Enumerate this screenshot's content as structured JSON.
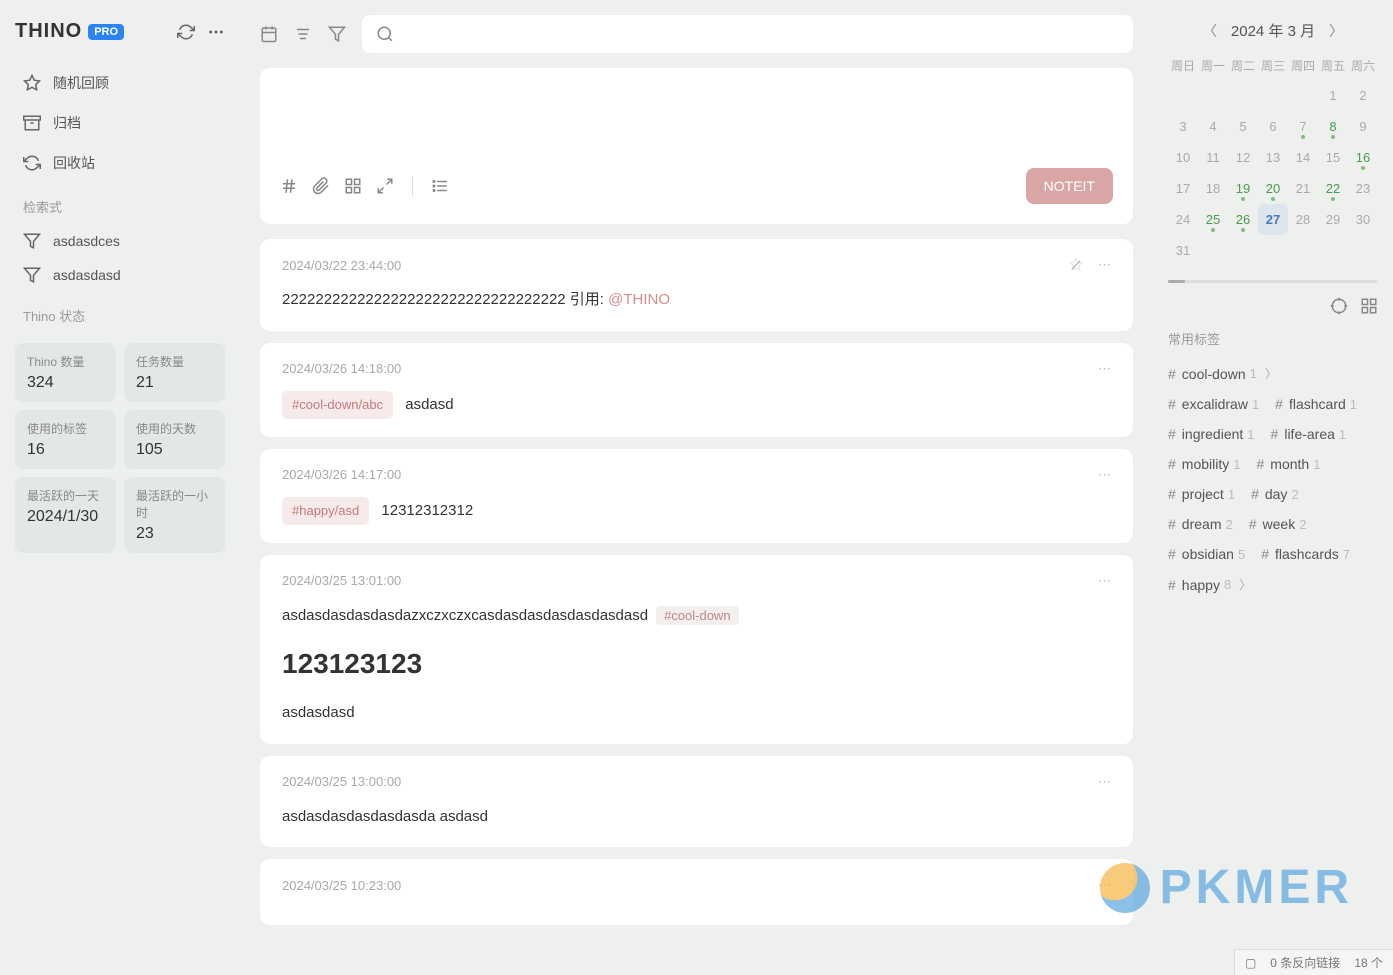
{
  "brand": {
    "title": "THINO",
    "badge": "PRO"
  },
  "sidebar": {
    "nav": [
      {
        "label": "随机回顾",
        "icon": "star"
      },
      {
        "label": "归档",
        "icon": "archive"
      },
      {
        "label": "回收站",
        "icon": "recycle"
      }
    ],
    "search_label": "检索式",
    "filters": [
      {
        "label": "asdasdces"
      },
      {
        "label": "asdasdasd"
      }
    ],
    "stats_label": "Thino 状态",
    "stats": [
      {
        "label": "Thino 数量",
        "value": "324"
      },
      {
        "label": "任务数量",
        "value": "21"
      },
      {
        "label": "使用的标签",
        "value": "16"
      },
      {
        "label": "使用的天数",
        "value": "105"
      },
      {
        "label": "最活跃的一天",
        "value": "2024/1/30"
      },
      {
        "label": "最活跃的一小时",
        "value": "23"
      }
    ]
  },
  "editor": {
    "submit": "NOTEIT"
  },
  "memos": [
    {
      "time": "2024/03/22 23:44:00",
      "pinned": true,
      "text_prefix": "2222222222222222222222222222222222 引用: ",
      "mention": "@THINO"
    },
    {
      "time": "2024/03/26 14:18:00",
      "tag": "#cool-down/abc",
      "text": "asdasd"
    },
    {
      "time": "2024/03/26 14:17:00",
      "tag": "#happy/asd",
      "text": "12312312312"
    },
    {
      "time": "2024/03/25 13:01:00",
      "text": "asdasdasdasdasdazxczxczxcasdasdasdasdasdasdasd",
      "tag_after": "#cool-down",
      "heading": "123123123",
      "text2": "asdasdasd"
    },
    {
      "time": "2024/03/25 13:00:00",
      "text": "asdasdasdasdasdasda asdasd"
    },
    {
      "time": "2024/03/25 10:23:00"
    }
  ],
  "calendar": {
    "title": "2024 年 3 月",
    "dow": [
      "周日",
      "周一",
      "周二",
      "周三",
      "周四",
      "周五",
      "周六"
    ],
    "weeks": [
      [
        {
          "d": ""
        },
        {
          "d": ""
        },
        {
          "d": ""
        },
        {
          "d": ""
        },
        {
          "d": ""
        },
        {
          "d": "1"
        },
        {
          "d": "2"
        }
      ],
      [
        {
          "d": "3"
        },
        {
          "d": "4"
        },
        {
          "d": "5"
        },
        {
          "d": "6"
        },
        {
          "d": "7",
          "dot": true
        },
        {
          "d": "8",
          "green": true,
          "dot": true
        },
        {
          "d": "9"
        }
      ],
      [
        {
          "d": "10"
        },
        {
          "d": "11"
        },
        {
          "d": "12"
        },
        {
          "d": "13"
        },
        {
          "d": "14"
        },
        {
          "d": "15"
        },
        {
          "d": "16",
          "green": true,
          "dot": true
        }
      ],
      [
        {
          "d": "17"
        },
        {
          "d": "18"
        },
        {
          "d": "19",
          "green": true,
          "dot": true
        },
        {
          "d": "20",
          "green": true,
          "dot": true
        },
        {
          "d": "21"
        },
        {
          "d": "22",
          "green": true,
          "dot": true
        },
        {
          "d": "23"
        }
      ],
      [
        {
          "d": "24"
        },
        {
          "d": "25",
          "green": true,
          "dot": true
        },
        {
          "d": "26",
          "green": true,
          "dot": true
        },
        {
          "d": "27",
          "today": true
        },
        {
          "d": "28"
        },
        {
          "d": "29"
        },
        {
          "d": "30"
        }
      ],
      [
        {
          "d": "31"
        },
        {
          "d": ""
        },
        {
          "d": ""
        },
        {
          "d": ""
        },
        {
          "d": ""
        },
        {
          "d": ""
        },
        {
          "d": ""
        }
      ]
    ]
  },
  "tags": {
    "label": "常用标签",
    "rows": [
      [
        {
          "name": "cool-down",
          "count": "1",
          "expand": true
        }
      ],
      [
        {
          "name": "excalidraw",
          "count": "1"
        },
        {
          "name": "flashcard",
          "count": "1"
        }
      ],
      [
        {
          "name": "ingredient",
          "count": "1"
        },
        {
          "name": "life-area",
          "count": "1"
        }
      ],
      [
        {
          "name": "mobility",
          "count": "1"
        },
        {
          "name": "month",
          "count": "1"
        }
      ],
      [
        {
          "name": "project",
          "count": "1"
        },
        {
          "name": "day",
          "count": "2"
        }
      ],
      [
        {
          "name": "dream",
          "count": "2"
        },
        {
          "name": "week",
          "count": "2"
        }
      ],
      [
        {
          "name": "obsidian",
          "count": "5"
        },
        {
          "name": "flashcards",
          "count": "7"
        }
      ],
      [
        {
          "name": "happy",
          "count": "8",
          "expand": true
        }
      ]
    ]
  },
  "statusbar": {
    "backlinks": "0 条反向链接",
    "words": "18 个"
  },
  "watermark": "PKMER"
}
